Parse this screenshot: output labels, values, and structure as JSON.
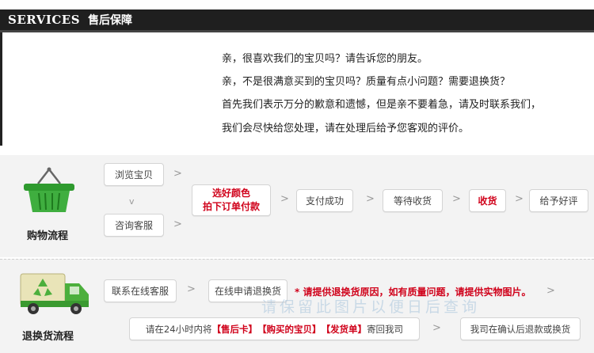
{
  "header": {
    "title_en": "SERVICES",
    "title_cn": "售后保障"
  },
  "message": {
    "lines": [
      "亲，很喜欢我们的宝贝吗？请告诉您的朋友。",
      "亲，不是很满意买到的宝贝吗？质量有点小问题？需要退换货？",
      "首先我们表示万分的歉意和遗憾，但是亲不要着急，请及时联系我们，",
      "我们会尽快给您处理，请在处理后给予您客观的评价。"
    ]
  },
  "shopping": {
    "label": "购物流程",
    "steps": {
      "browse": "浏览宝贝",
      "consult": "咨询客服",
      "choose_line1": "选好颜色",
      "choose_line2": "拍下订单付款",
      "paid": "支付成功",
      "wait": "等待收货",
      "receive": "收货",
      "review": "给予好评"
    },
    "arrow": ">",
    "down_arrow": "v"
  },
  "returns": {
    "label": "退换货流程",
    "steps": {
      "contact": "联系在线客服",
      "apply": "在线申请退换货",
      "send_prefix": "请在24小时内将",
      "send_card": "【售后卡】",
      "send_item": "【购买的宝贝】",
      "send_invoice": "【发货单】",
      "send_suffix": "寄回我司",
      "confirm": "我司在确认后退款或换货"
    },
    "note": "* 请提供退换货原因，如有质量问题，请提供实物图片。",
    "arrow": ">"
  },
  "icons": {
    "basket": "shopping-basket-icon",
    "truck": "recycle-truck-icon"
  },
  "colors": {
    "accent_red": "#d0021b",
    "basket_green": "#2e9a2e",
    "truck_green": "#4caf3c"
  },
  "watermark": "请保留此图片以便日后查询"
}
